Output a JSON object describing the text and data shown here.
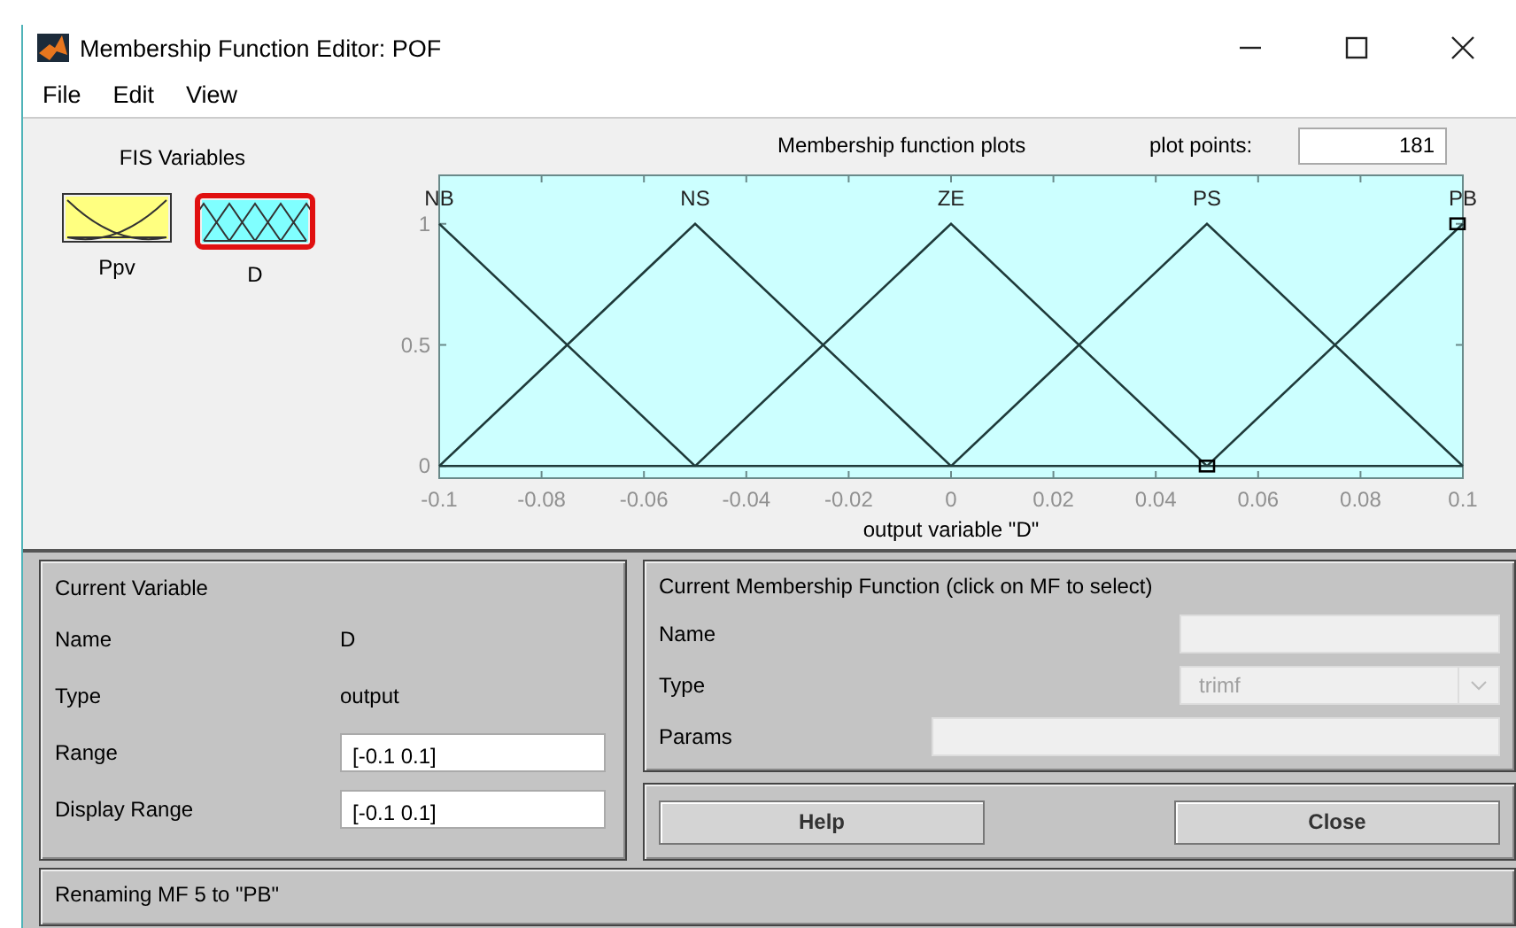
{
  "window": {
    "title": "Membership Function Editor: POF"
  },
  "menu": [
    "File",
    "Edit",
    "View"
  ],
  "fis_variables": {
    "title": "FIS Variables",
    "items": [
      {
        "label": "Ppv",
        "kind": "input",
        "selected": false
      },
      {
        "label": "D",
        "kind": "output",
        "selected": true
      }
    ]
  },
  "plot": {
    "plot_points_label": "plot points:",
    "plot_points": "181",
    "chart_data": {
      "type": "line",
      "title": "Membership function plots",
      "xlabel": "output variable \"D\"",
      "x": [
        -0.1,
        -0.05,
        0,
        0.05,
        0.1
      ],
      "series": [
        {
          "name": "NB",
          "color": "#1f3a3a",
          "values": [
            1,
            0,
            null,
            null,
            null
          ]
        },
        {
          "name": "NS",
          "color": "#1f3a3a",
          "values": [
            0,
            1,
            0,
            null,
            null
          ]
        },
        {
          "name": "ZE",
          "color": "#1f3a3a",
          "values": [
            null,
            0,
            1,
            0,
            null
          ]
        },
        {
          "name": "PS",
          "color": "#1f3a3a",
          "values": [
            null,
            null,
            0,
            1,
            0
          ]
        },
        {
          "name": "PB",
          "color": "#1f3a3a",
          "values": [
            null,
            null,
            null,
            0,
            1
          ]
        }
      ],
      "xlim": [
        -0.1,
        0.1
      ],
      "ylim": [
        -0.05,
        1.2
      ],
      "xticks": [
        -0.1,
        -0.08,
        -0.06,
        -0.04,
        -0.02,
        0,
        0.02,
        0.04,
        0.06,
        0.08,
        0.1
      ],
      "yticks": [
        0,
        0.5,
        1
      ]
    },
    "membership_functions": [
      {
        "selected": false
      },
      {
        "selected": false
      },
      {
        "selected": false
      },
      {
        "selected": false
      },
      {
        "selected": true
      }
    ]
  },
  "current_variable": {
    "title": "Current Variable",
    "name_label": "Name",
    "name": "D",
    "type_label": "Type",
    "type": "output",
    "range_label": "Range",
    "range": "[-0.1 0.1]",
    "display_range_label": "Display Range",
    "display_range": "[-0.1 0.1]"
  },
  "current_mf": {
    "title": "Current Membership Function (click on MF to select)",
    "name_label": "Name",
    "type_label": "Type",
    "type": "trimf",
    "params_label": "Params",
    "disabled": true
  },
  "buttons": [
    "Help",
    "Close"
  ],
  "status": "Renaming MF 5 to \"PB\""
}
